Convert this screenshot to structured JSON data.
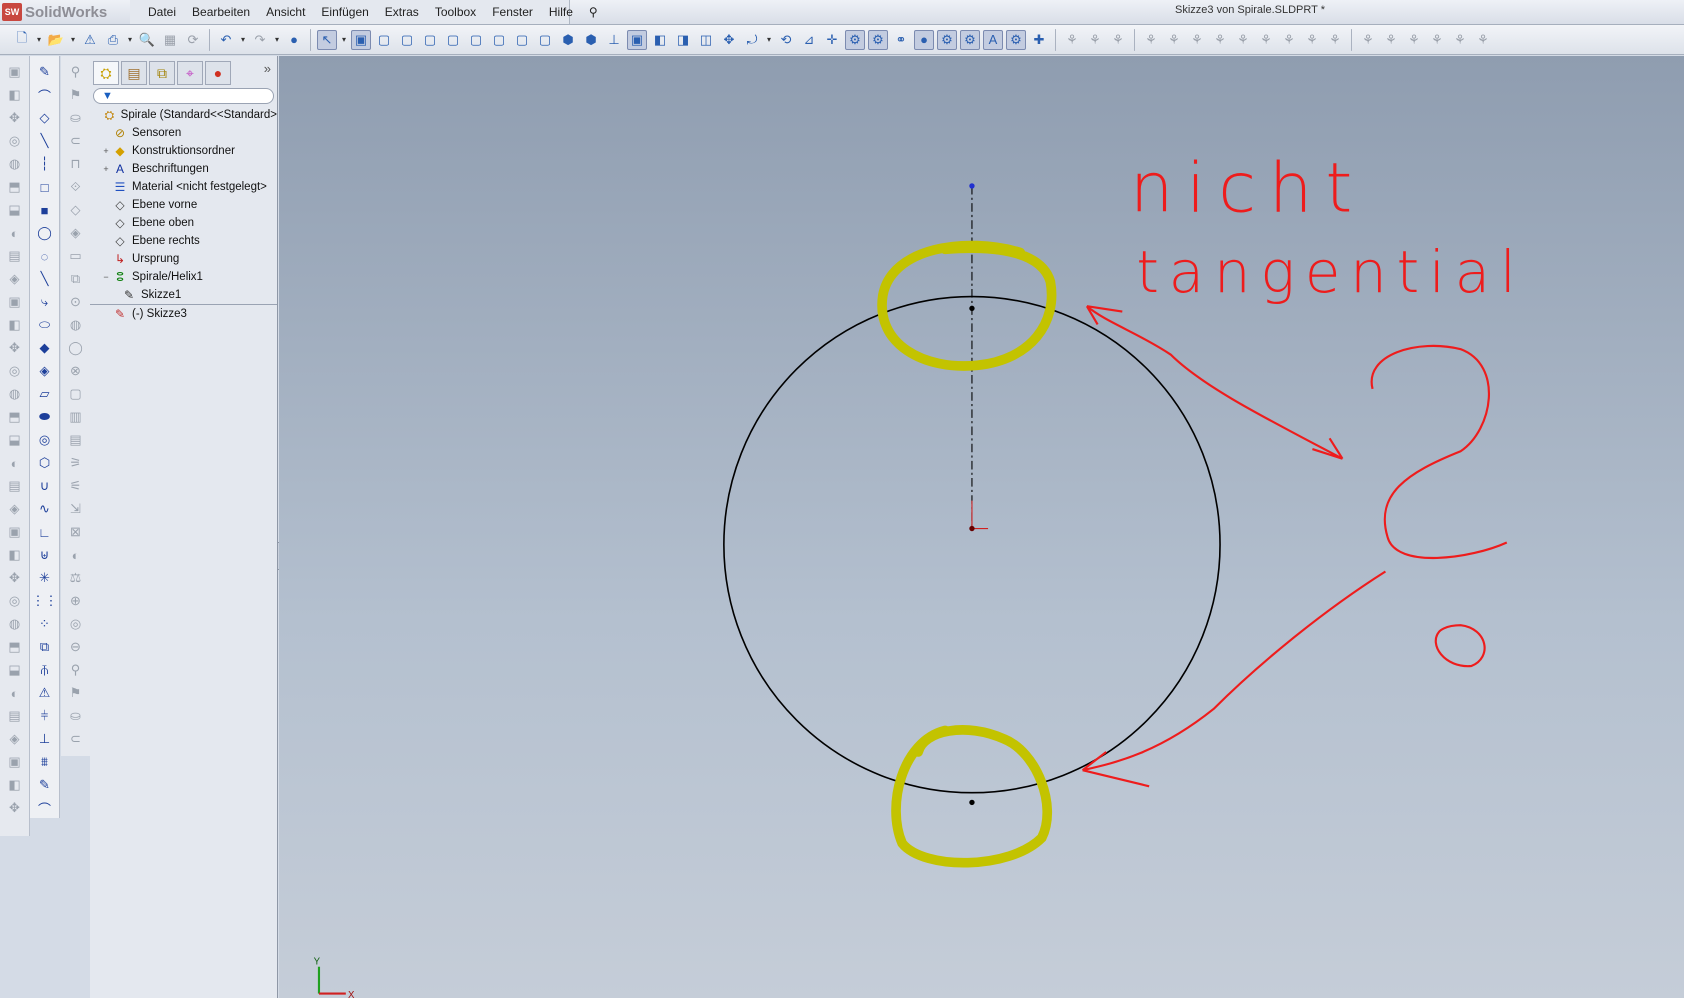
{
  "app": {
    "name": "SolidWorks",
    "logo_text": "SW",
    "document_title": "Skizze3 von Spirale.SLDPRT *"
  },
  "menu": [
    "Datei",
    "Bearbeiten",
    "Ansicht",
    "Einfügen",
    "Extras",
    "Toolbox",
    "Fenster",
    "Hilfe"
  ],
  "tree": {
    "filter_icon": "funnel-icon",
    "more": "»",
    "nodes": [
      {
        "label": "Spirale  (Standard<<Standard>",
        "icon": "part-icon",
        "level": 0,
        "exp": ""
      },
      {
        "label": "Sensoren",
        "icon": "sensor-folder-icon",
        "level": 1,
        "exp": ""
      },
      {
        "label": "Konstruktionsordner",
        "icon": "design-binder-icon",
        "level": 1,
        "exp": "+"
      },
      {
        "label": "Beschriftungen",
        "icon": "annotations-icon",
        "level": 1,
        "exp": "+"
      },
      {
        "label": "Material <nicht festgelegt>",
        "icon": "material-icon",
        "level": 1,
        "exp": ""
      },
      {
        "label": "Ebene vorne",
        "icon": "plane-icon",
        "level": 1,
        "exp": ""
      },
      {
        "label": "Ebene oben",
        "icon": "plane-icon",
        "level": 1,
        "exp": ""
      },
      {
        "label": "Ebene rechts",
        "icon": "plane-icon",
        "level": 1,
        "exp": ""
      },
      {
        "label": "Ursprung",
        "icon": "origin-icon",
        "level": 1,
        "exp": ""
      },
      {
        "label": "Spirale/Helix1",
        "icon": "helix-icon",
        "level": 1,
        "exp": "−"
      },
      {
        "label": "Skizze1",
        "icon": "sketch-icon",
        "level": 2,
        "exp": ""
      },
      {
        "label": "(-) Skizze3",
        "icon": "sketch-edit-icon",
        "level": 1,
        "exp": ""
      }
    ]
  },
  "annotations": {
    "line1": "nicht",
    "line2": "tangential",
    "question": "?"
  },
  "axis": {
    "y": "Y",
    "x": "X"
  },
  "colors": {
    "highlight": "#c3c300",
    "annotation": "#ee1c1c",
    "sketch": "#000000"
  }
}
